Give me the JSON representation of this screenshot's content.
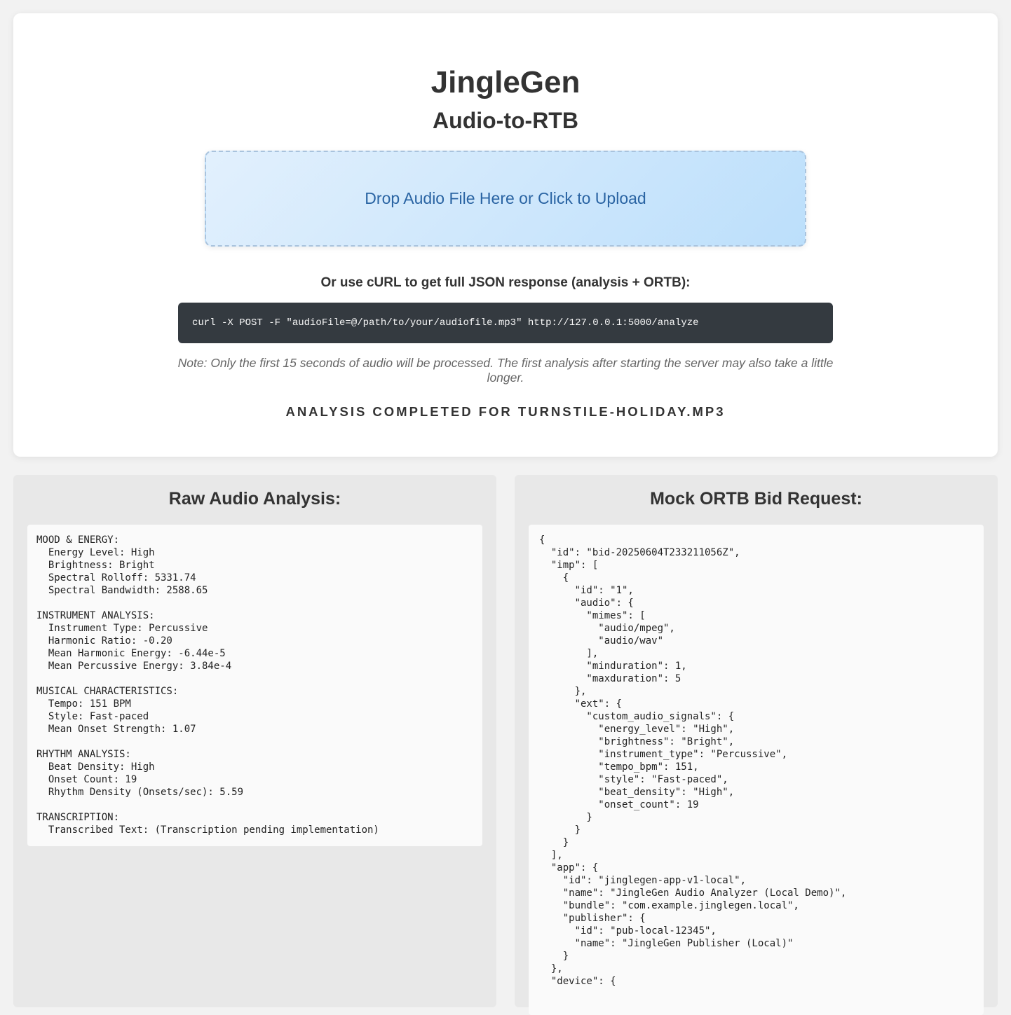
{
  "header": {
    "title": "JingleGen",
    "subtitle": "Audio-to-RTB"
  },
  "upload": {
    "label": "Drop Audio File Here or Click to Upload"
  },
  "curl": {
    "heading": "Or use cURL to get full JSON response (analysis + ORTB):",
    "command": "curl -X POST -F \"audioFile=@/path/to/your/audiofile.mp3\" http://127.0.0.1:5000/analyze"
  },
  "note": "Note: Only the first 15 seconds of audio will be processed. The first analysis after starting the server may also take a little longer.",
  "status": "Analysis completed for turnstile-holiday.mp3",
  "analysis": {
    "title": "Raw Audio Analysis:",
    "sections": [
      {
        "heading": "MOOD & ENERGY:",
        "lines": [
          "  Energy Level: High",
          "  Brightness: Bright",
          "  Spectral Rolloff: 5331.74",
          "  Spectral Bandwidth: 2588.65"
        ]
      },
      {
        "heading": "INSTRUMENT ANALYSIS:",
        "lines": [
          "  Instrument Type: Percussive",
          "  Harmonic Ratio: -0.20",
          "  Mean Harmonic Energy: -6.44e-5",
          "  Mean Percussive Energy: 3.84e-4"
        ]
      },
      {
        "heading": "MUSICAL CHARACTERISTICS:",
        "lines": [
          "  Tempo: 151 BPM",
          "  Style: Fast-paced",
          "  Mean Onset Strength: 1.07"
        ]
      },
      {
        "heading": "RHYTHM ANALYSIS:",
        "lines": [
          "  Beat Density: High",
          "  Onset Count: 19",
          "  Rhythm Density (Onsets/sec): 5.59"
        ]
      },
      {
        "heading": "TRANSCRIPTION:",
        "lines": [
          "  Transcribed Text: (Transcription pending implementation)"
        ]
      }
    ]
  },
  "ortb": {
    "title": "Mock ORTB Bid Request:",
    "lines": [
      "{",
      "  \"id\": \"bid-20250604T233211056Z\",",
      "  \"imp\": [",
      "    {",
      "      \"id\": \"1\",",
      "      \"audio\": {",
      "        \"mimes\": [",
      "          \"audio/mpeg\",",
      "          \"audio/wav\"",
      "        ],",
      "        \"minduration\": 1,",
      "        \"maxduration\": 5",
      "      },",
      "      \"ext\": {",
      "        \"custom_audio_signals\": {",
      "          \"energy_level\": \"High\",",
      "          \"brightness\": \"Bright\",",
      "          \"instrument_type\": \"Percussive\",",
      "          \"tempo_bpm\": 151,",
      "          \"style\": \"Fast-paced\",",
      "          \"beat_density\": \"High\",",
      "          \"onset_count\": 19",
      "        }",
      "      }",
      "    }",
      "  ],",
      "  \"app\": {",
      "    \"id\": \"jinglegen-app-v1-local\",",
      "    \"name\": \"JingleGen Audio Analyzer (Local Demo)\",",
      "    \"bundle\": \"com.example.jinglegen.local\",",
      "    \"publisher\": {",
      "      \"id\": \"pub-local-12345\",",
      "      \"name\": \"JingleGen Publisher (Local)\"",
      "    }",
      "  },",
      "  \"device\": {"
    ]
  }
}
